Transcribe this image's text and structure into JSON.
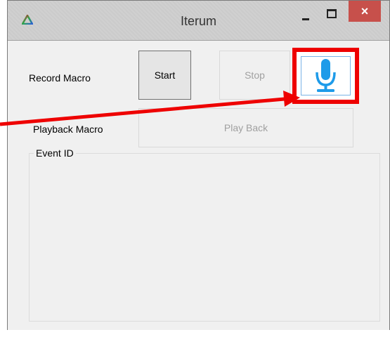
{
  "window": {
    "title": "Iterum",
    "close_glyph": "×"
  },
  "record": {
    "label": "Record Macro",
    "start_label": "Start",
    "stop_label": "Stop"
  },
  "playback": {
    "label": "Playback Macro",
    "play_back_label": "Play Back"
  },
  "event_group": {
    "title": "Event ID"
  },
  "icons": {
    "app": "triangle-logo-icon",
    "voice": "microphone-icon"
  },
  "colors": {
    "highlight": "#ee0000",
    "mic": "#1e9be9",
    "close": "#c7504b"
  }
}
